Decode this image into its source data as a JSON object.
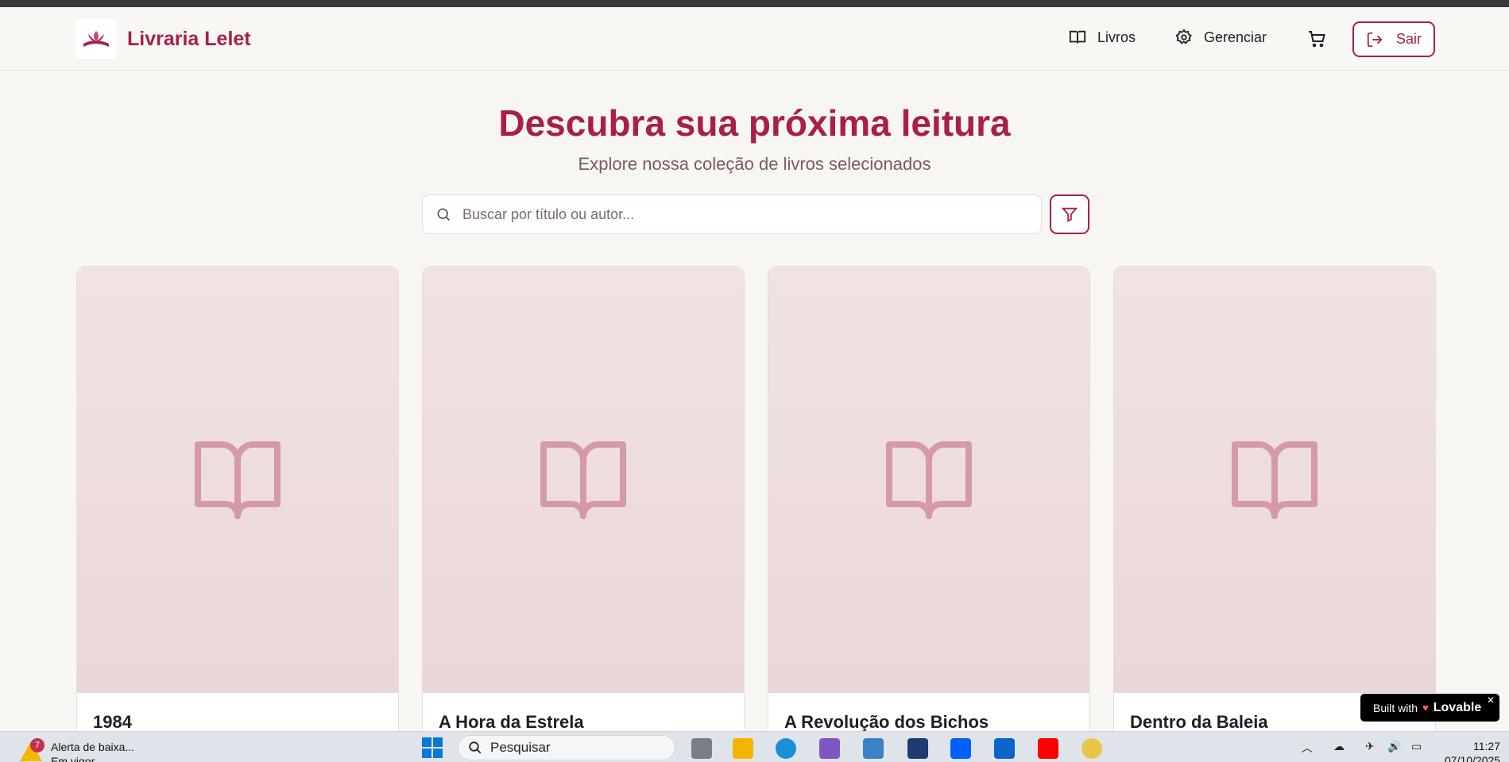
{
  "header": {
    "brand": "Livraria Lelet",
    "nav": {
      "books": "Livros",
      "manage": "Gerenciar",
      "logout": "Sair"
    }
  },
  "hero": {
    "title": "Descubra sua próxima leitura",
    "subtitle": "Explore nossa coleção de livros selecionados"
  },
  "search": {
    "placeholder": "Buscar por título ou autor..."
  },
  "books": [
    {
      "title": "1984"
    },
    {
      "title": "A Hora da Estrela"
    },
    {
      "title": "A Revolução dos Bichos"
    },
    {
      "title": "Dentro da Baleia"
    }
  ],
  "badge": {
    "prefix": "Built with",
    "brand": "Lovable",
    "close": "✕"
  },
  "taskbar": {
    "alert_count": "7",
    "alert_title": "Alerta de baixa...",
    "alert_sub": "Em vigor",
    "search_label": "Pesquisar",
    "time": "11:27",
    "date": "07/10/2025"
  },
  "colors": {
    "accent": "#a81f4a",
    "cover": "#ecd9db",
    "background": "#f8f6f3"
  }
}
